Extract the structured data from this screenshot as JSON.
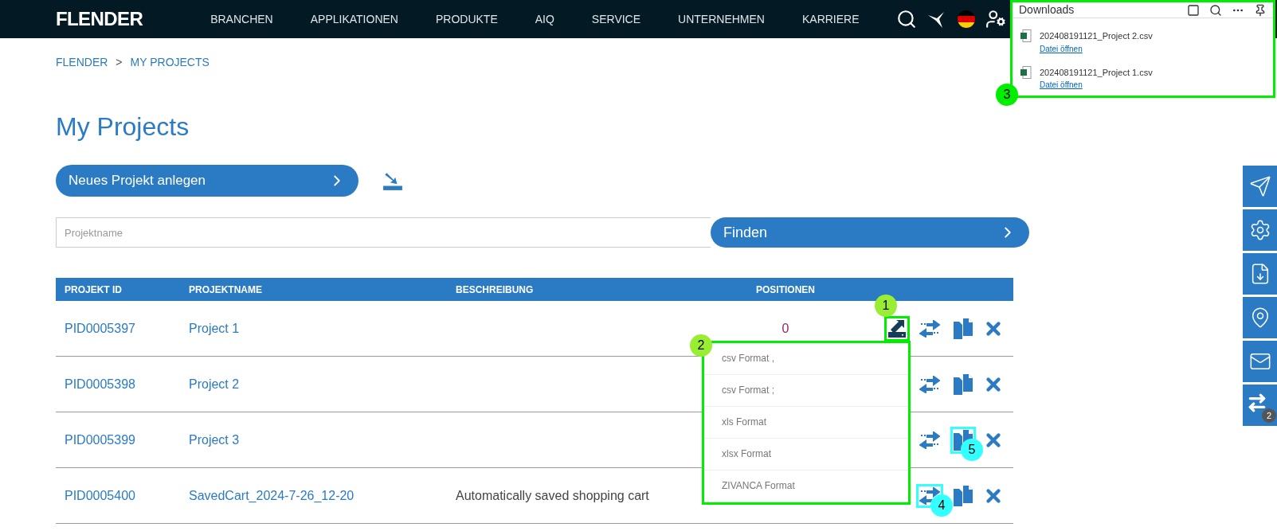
{
  "nav": {
    "logo": "FLENDER",
    "items": [
      "BRANCHEN",
      "APPLIKATIONEN",
      "PRODUKTE",
      "AIQ",
      "SERVICE",
      "UNTERNEHMEN",
      "KARRIERE"
    ]
  },
  "breadcrumb": [
    "FLENDER",
    ">",
    "MY PROJECTS"
  ],
  "title": "My Projects",
  "new_project_button": "Neues Projekt anlegen",
  "search": {
    "placeholder": "Projektname",
    "button": "Finden"
  },
  "table": {
    "columns": [
      "PROJEKT ID",
      "PROJEKTNAME",
      "BESCHREIBUNG",
      "POSITIONEN"
    ],
    "rows": [
      {
        "id": "PID0005397",
        "name": "Project 1",
        "description": "",
        "positions": "0",
        "export_menu_open": true
      },
      {
        "id": "PID0005398",
        "name": "Project 2",
        "description": "",
        "positions": "",
        "export_menu_open": false
      },
      {
        "id": "PID0005399",
        "name": "Project 3",
        "description": "",
        "positions": "",
        "export_menu_open": false
      },
      {
        "id": "PID0005400",
        "name": "SavedCart_2024-7-26_12-20",
        "description": "Automatically saved shopping cart",
        "positions": "",
        "export_menu_open": false
      }
    ]
  },
  "export_menu": [
    "csv Format ,",
    "csv Format ;",
    "xls Format",
    "xlsx Format",
    "ZIVANCA Format"
  ],
  "downloads": {
    "title": "Downloads",
    "items": [
      {
        "filename": "202408191121_Project 2.csv",
        "action": "Datei öffnen"
      },
      {
        "filename": "202408191121_Project 1.csv",
        "action": "Datei öffnen"
      }
    ]
  },
  "side_toolbar": {
    "badge": "2"
  },
  "annotations": [
    {
      "label": "1",
      "color": "#99ee33"
    },
    {
      "label": "2",
      "color": "#99ee33"
    },
    {
      "label": "3",
      "color": "#00ee00"
    },
    {
      "label": "4",
      "color": "#33ffff"
    },
    {
      "label": "5",
      "color": "#33ffff"
    }
  ]
}
